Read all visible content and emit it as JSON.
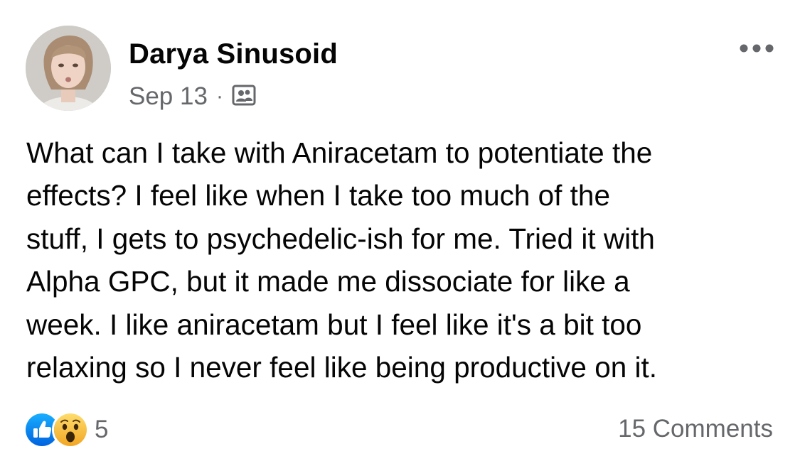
{
  "post": {
    "author": "Darya Sinusoid",
    "date": "Sep 13",
    "separator": "·",
    "audience_icon": "friends-icon",
    "more_icon": "more-dots-icon",
    "body_lines": [
      "What can I take with Aniracetam to potentiate the",
      "effects? I feel like when I take too much of the",
      "stuff, I gets to psychedelic-ish for me. Tried it with",
      "Alpha GPC, but it made me dissociate for like a",
      "week. I like aniracetam but I feel like it's a bit too",
      "relaxing so I never feel like being productive on it."
    ]
  },
  "footer": {
    "reaction_icons": [
      "like-icon",
      "wow-icon"
    ],
    "reaction_count": "5",
    "comments_label": "15 Comments"
  },
  "colors": {
    "text_primary": "#050505",
    "text_secondary": "#65676b",
    "like_blue": "#1877f2",
    "wow_yellow": "#f7b928"
  }
}
